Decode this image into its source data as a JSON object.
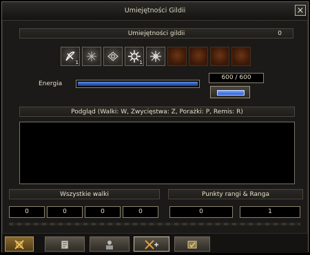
{
  "window": {
    "title": "Umiejętności Gildii",
    "close_icon": "close-icon"
  },
  "skills": {
    "header_label": "Umiejętności gildii",
    "header_count": "0",
    "slots": [
      {
        "icon": "bow-skill-icon",
        "active": true,
        "level": "1"
      },
      {
        "icon": "frost-skill-icon",
        "active": true,
        "level": ""
      },
      {
        "icon": "eye-skill-icon",
        "active": true,
        "level": ""
      },
      {
        "icon": "burst-skill-icon",
        "active": true,
        "level": "1"
      },
      {
        "icon": "snowflake-skill-icon",
        "active": true,
        "level": ""
      },
      {
        "icon": "empty-slot",
        "active": false,
        "level": ""
      },
      {
        "icon": "empty-slot",
        "active": false,
        "level": ""
      },
      {
        "icon": "empty-slot",
        "active": false,
        "level": ""
      },
      {
        "icon": "empty-slot",
        "active": false,
        "level": ""
      }
    ]
  },
  "energy": {
    "label": "Energia",
    "current": 600,
    "max": 600,
    "display": "600 / 600",
    "fill_fraction": 1.0,
    "bar_color": "#3a6ad0"
  },
  "preview": {
    "label": "Podgląd (Walki: W, Zwycięstwa: Z, Porażki: P, Remis: R)"
  },
  "all_fights": {
    "label": "Wszystkie walki",
    "values": [
      "0",
      "0",
      "0",
      "0"
    ]
  },
  "rank": {
    "label": "Punkty rangi  &  Ranga",
    "points": "0",
    "rank": "1"
  },
  "bottom_tabs": [
    {
      "icon": "guild-emblem-icon",
      "active": true
    },
    {
      "icon": "notes-icon",
      "active": false
    },
    {
      "icon": "members-icon",
      "active": false
    },
    {
      "icon": "crossed-swords-icon",
      "active": false
    },
    {
      "icon": "approve-icon",
      "active": false
    }
  ]
}
